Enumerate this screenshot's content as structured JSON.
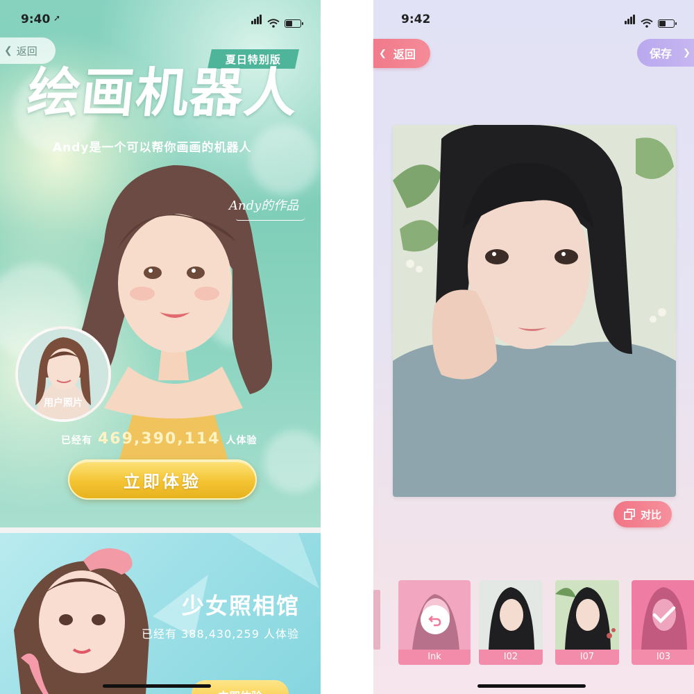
{
  "left_screen": {
    "status": {
      "time": "9:40"
    },
    "back_label": "返回",
    "edition_tag": "夏日特别版",
    "title": "绘画机器人",
    "subtitle": "Andy是一个可以帮你画画的机器人",
    "artwork_caption": "Andy的作品",
    "user_photo_label": "用户照片",
    "experience_prefix": "已经有",
    "experience_count": "469,390,114",
    "experience_suffix": "人体验",
    "cta_label": "立即体验",
    "promo": {
      "title": "少女照相馆",
      "count_text": "已经有 388,430,259 人体验",
      "cta_label": "立即体验"
    }
  },
  "right_screen": {
    "status": {
      "time": "9:42"
    },
    "back_label": "返回",
    "save_label": "保存",
    "compare_label": "对比",
    "styles": [
      {
        "label": "Ink",
        "selected": false,
        "overlay": "undo-icon"
      },
      {
        "label": "I02",
        "selected": false
      },
      {
        "label": "I07",
        "selected": false
      },
      {
        "label": "I03",
        "selected": true,
        "overlay": "check-icon"
      }
    ]
  },
  "colors": {
    "left_bg": "#86d2bf",
    "cta_gold": "#f4c433",
    "right_bg": "#e1e2f5",
    "accent_pink": "#f07585",
    "accent_purple": "#b9a8ee",
    "style_label_bg": "#f38bab"
  }
}
